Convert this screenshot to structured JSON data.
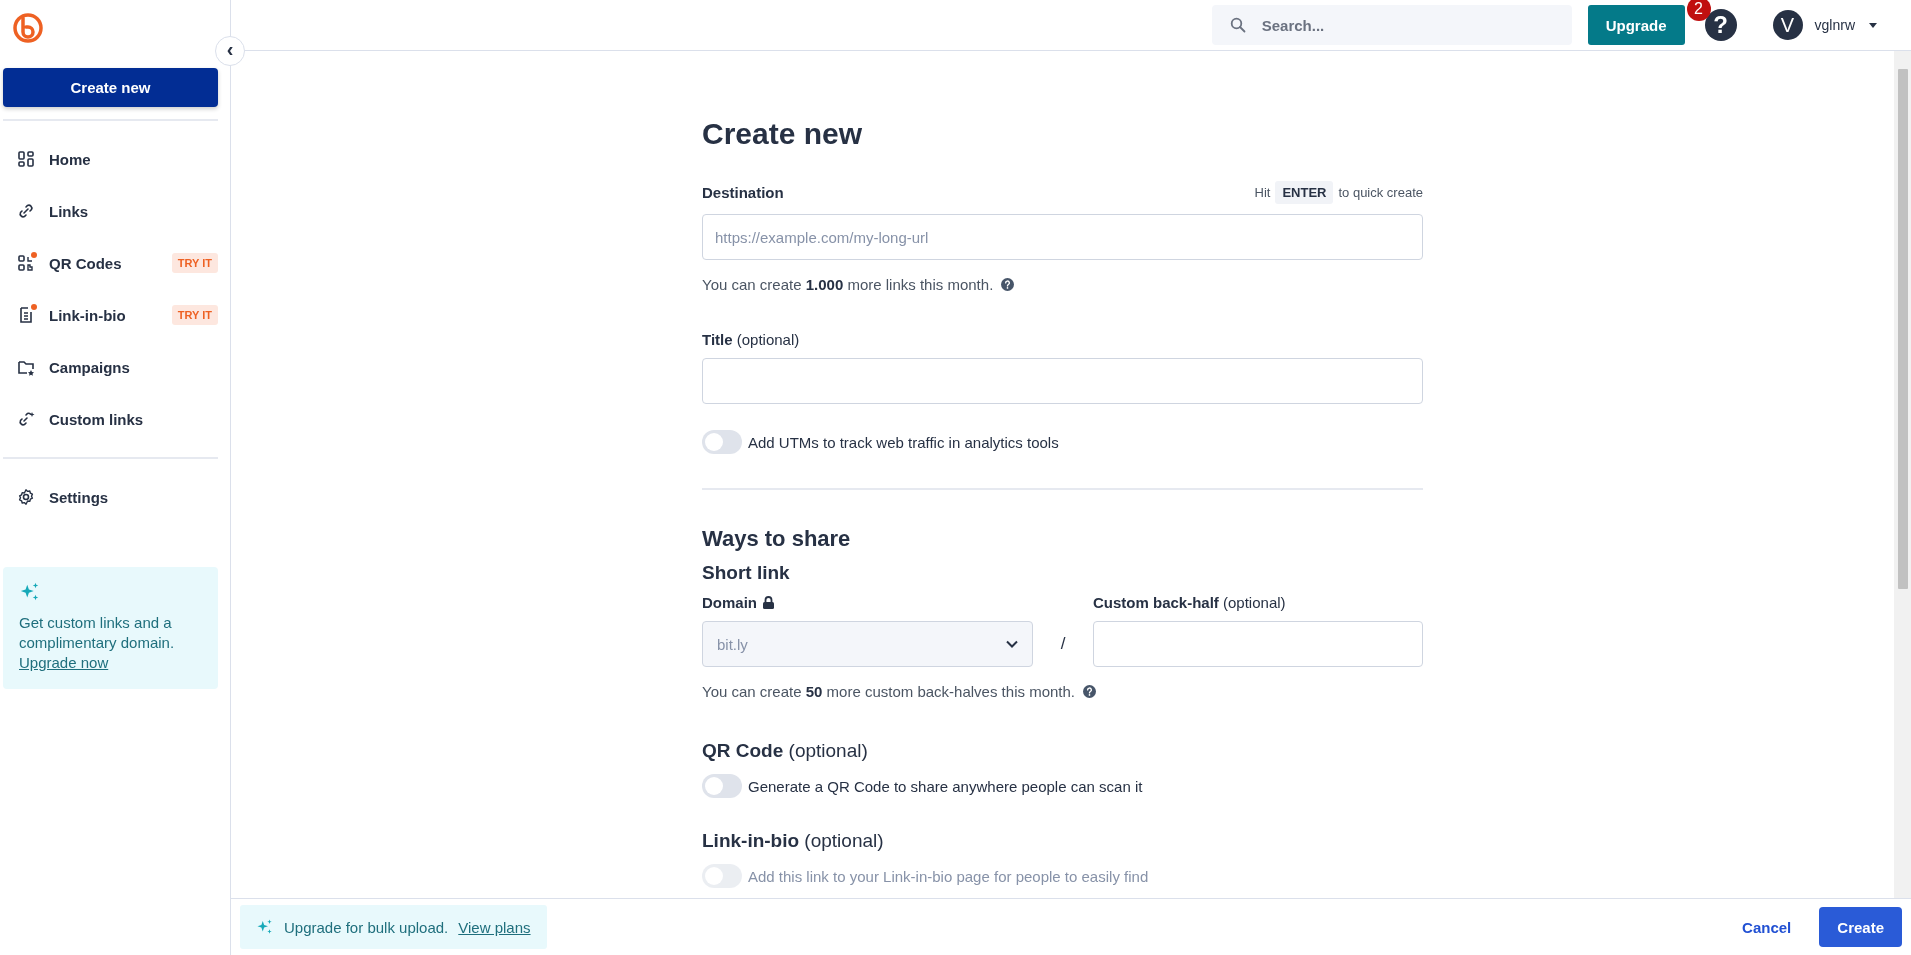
{
  "sidebar": {
    "create_button": "Create new",
    "collapse_icon": "‹",
    "items": [
      {
        "kind": "home",
        "label": "Home",
        "new_dot": false,
        "selected": false
      },
      {
        "kind": "links",
        "label": "Links",
        "new_dot": false,
        "selected": false
      },
      {
        "kind": "qr",
        "label": "QR Codes",
        "badge": "TRY IT",
        "new_dot": true,
        "selected": false
      },
      {
        "kind": "bio",
        "label": "Link-in-bio",
        "badge": "TRY IT",
        "new_dot": true,
        "selected": false
      },
      {
        "kind": "campaigns",
        "label": "Campaigns",
        "new_dot": false,
        "selected": false
      },
      {
        "kind": "custom",
        "label": "Custom links",
        "new_dot": false,
        "selected": false
      },
      {
        "kind": "settings",
        "label": "Settings",
        "new_dot": false,
        "selected": false
      }
    ],
    "promo": {
      "text": "Get custom links and a complimentary domain.",
      "link": "Upgrade now"
    }
  },
  "header": {
    "search": {
      "placeholder": "Search..."
    },
    "upgrade_button": "Upgrade",
    "help_badge": "2",
    "help_icon": "?",
    "user": {
      "initial": "V",
      "name": "vglnrw"
    }
  },
  "form": {
    "title": "Create new",
    "destination": {
      "label": "Destination",
      "hint_before": "Hit",
      "hint_key": "ENTER",
      "hint_after": "to quick create",
      "placeholder": "https://example.com/my-long-url",
      "note": "You can create **1.000** more links this month."
    },
    "title_field": {
      "label": "**Title** (optional)"
    },
    "utm_toggle": {
      "label": "Add UTMs to track web traffic in analytics tools",
      "on": false,
      "disabled": false
    },
    "share": {
      "heading": "Ways to share",
      "subheading": "Short link",
      "domain_label": "Domain",
      "domain_value": "bit.ly",
      "slash": "/",
      "backhalf_label": "**Custom back-half** (optional)",
      "note": "You can create **50** more custom back-halves this month."
    },
    "qr": {
      "heading": "**QR Code** (optional)",
      "toggle": {
        "label": "Generate a QR Code to share anywhere people can scan it",
        "on": false,
        "disabled": false
      }
    },
    "bio": {
      "heading": "**Link-in-bio** (optional)",
      "toggle": {
        "label": "Add this link to your Link-in-bio page for people to easily find",
        "on": false,
        "disabled": true
      }
    }
  },
  "footer": {
    "promo": "Upgrade for bulk upload.",
    "promo_link": "View plans",
    "cancel": "Cancel",
    "create": "Create"
  }
}
